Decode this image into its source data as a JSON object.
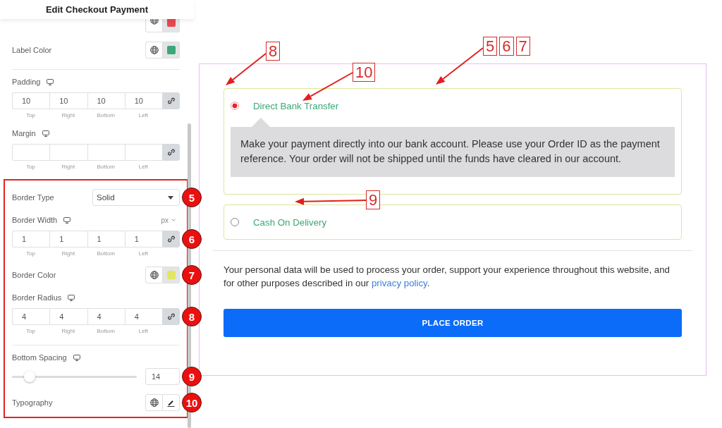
{
  "panel": {
    "title": "Edit Checkout Payment",
    "sections": [
      {
        "highlighted": false,
        "controls": [
          {
            "kind": "color_partial",
            "color": "#e5484d"
          },
          {
            "kind": "color",
            "label": "Label Color",
            "responsive": false,
            "color": "#3aa876"
          },
          {
            "kind": "divider"
          },
          {
            "kind": "dimensions",
            "label": "Padding",
            "responsive": true,
            "values": [
              "10",
              "10",
              "10",
              "10"
            ],
            "sides": [
              "Top",
              "Right",
              "Bottom",
              "Left"
            ]
          },
          {
            "kind": "dimensions",
            "label": "Margin",
            "responsive": true,
            "sides": [
              "Top",
              "Right",
              "Bottom",
              "Left"
            ]
          }
        ]
      },
      {
        "highlighted": true,
        "controls": [
          {
            "kind": "select",
            "label": "Border Type",
            "responsive": false,
            "value": "Solid",
            "marker": "5"
          },
          {
            "kind": "dimensions",
            "label": "Border Width",
            "responsive": true,
            "unit": "px",
            "values": [
              "1",
              "1",
              "1",
              "1"
            ],
            "sides": [
              "Top",
              "Right",
              "Bottom",
              "Left"
            ],
            "marker": "6"
          },
          {
            "kind": "color",
            "label": "Border Color",
            "responsive": false,
            "color": "#e3e65e",
            "marker": "7"
          },
          {
            "kind": "dimensions",
            "label": "Border Radius",
            "responsive": true,
            "values": [
              "4",
              "4",
              "4",
              "4"
            ],
            "sides": [
              "Top",
              "Right",
              "Bottom",
              "Left"
            ],
            "marker": "8"
          },
          {
            "kind": "divider"
          },
          {
            "kind": "slider",
            "label": "Bottom Spacing",
            "responsive": true,
            "level": 0.14,
            "value": "14",
            "marker": "9"
          },
          {
            "kind": "typography",
            "label": "Typography",
            "responsive": false,
            "marker": "10"
          }
        ]
      }
    ]
  },
  "preview": {
    "payment_methods": [
      {
        "label": "Direct Bank Transfer",
        "selected": true,
        "description": "Make your payment directly into our bank account. Please use your Order ID as the payment reference. Your order will not be shipped until the funds have cleared in our account."
      },
      {
        "label": "Cash On Delivery",
        "selected": false
      }
    ],
    "privacy": {
      "text": "Your personal data will be used to process your order, support your experience throughout this website, and for other purposes described in our ",
      "link": "privacy policy",
      "after": "."
    },
    "button": "PLACE ORDER"
  },
  "callouts": [
    {
      "labels": [
        "8"
      ]
    },
    {
      "labels": [
        "10"
      ]
    },
    {
      "labels": [
        "5",
        "6",
        "7"
      ]
    },
    {
      "labels": [
        "9"
      ]
    }
  ]
}
